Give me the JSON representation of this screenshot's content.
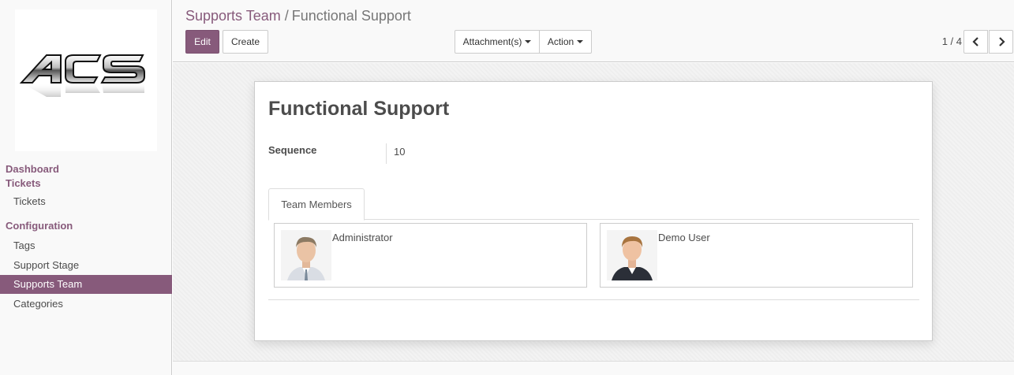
{
  "sidebar": {
    "logo_text": "ACS",
    "dashboard": "Dashboard",
    "tickets_head": "Tickets",
    "tickets_item": "Tickets",
    "config_head": "Configuration",
    "config_items": [
      "Tags",
      "Support Stage",
      "Supports Team",
      "Categories"
    ]
  },
  "breadcrumb": {
    "parent": "Supports Team",
    "separator": "/",
    "current": "Functional Support"
  },
  "toolbar": {
    "edit": "Edit",
    "create": "Create",
    "attachments": "Attachment(s)",
    "action": "Action"
  },
  "pager": {
    "value": "1 / 4",
    "prev_icon": "chevron-left-icon",
    "next_icon": "chevron-right-icon"
  },
  "record": {
    "title": "Functional Support",
    "sequence_label": "Sequence",
    "sequence_value": "10",
    "tab_label": "Team Members",
    "members": [
      {
        "name": "Administrator"
      },
      {
        "name": "Demo User"
      }
    ]
  },
  "colors": {
    "accent": "#875a7b"
  }
}
